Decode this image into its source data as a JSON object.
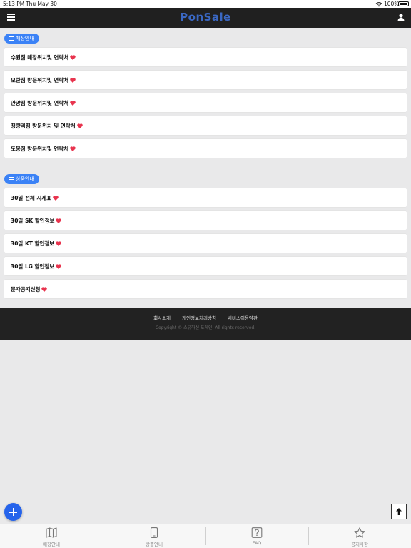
{
  "status_bar": {
    "time": "5:13 PM",
    "date": "Thu May 30",
    "battery": "100%"
  },
  "header": {
    "logo": "PonSale",
    "logo_color": "#3a67c2"
  },
  "sections": [
    {
      "title": "매장안내",
      "items": [
        {
          "label": "수원점 매장위치및 연락처"
        },
        {
          "label": "모란점 방문위치및 연락처"
        },
        {
          "label": "안양점 방문위치및 연락처"
        },
        {
          "label": "청량리점 방문위치 및 연락처"
        },
        {
          "label": "도봉점 방문위치및 연락처"
        }
      ]
    },
    {
      "title": "상품안내",
      "items": [
        {
          "label": "30일 전체 시세표"
        },
        {
          "label": "30일 SK 할인정보"
        },
        {
          "label": "30일 KT 할인정보"
        },
        {
          "label": "30일 LG 할인정보"
        },
        {
          "label": "문자공지신청"
        }
      ]
    }
  ],
  "footer": {
    "links": [
      "회사소개",
      "개인정보처리방침",
      "서비스이용약관"
    ],
    "copyright": "Copyright © 소유하신 도메인. All rights reserved."
  },
  "tabs": [
    {
      "label": "매장안내",
      "icon": "map-icon"
    },
    {
      "label": "상품안내",
      "icon": "phone-icon"
    },
    {
      "label": "FAQ",
      "icon": "question-icon"
    },
    {
      "label": "공지사항",
      "icon": "star-icon"
    }
  ],
  "colors": {
    "accent": "#3b82f6",
    "heart": "#e8344e",
    "nav_bg": "#202020",
    "footer_bg": "#222222"
  }
}
